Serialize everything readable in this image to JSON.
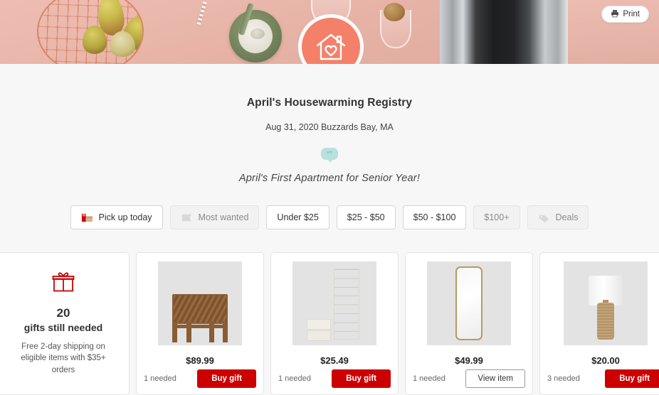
{
  "banner": {
    "print_label": "Print",
    "print_icon": "printer-icon",
    "avatar_icon": "house-heart-icon",
    "avatar_color": "#f58069"
  },
  "registry": {
    "title": "April's Housewarming Registry",
    "meta": "Aug 31, 2020 Buzzards Bay, MA",
    "quote_glyph": "“”",
    "note": "April's First Apartment for Senior Year!"
  },
  "filters": [
    {
      "label": "Pick up today",
      "icon": "store-pickup-icon",
      "disabled": false
    },
    {
      "label": "Most wanted",
      "icon": "ribbon-icon",
      "disabled": true
    },
    {
      "label": "Under $25",
      "icon": "",
      "disabled": false
    },
    {
      "label": "$25 - $50",
      "icon": "",
      "disabled": false
    },
    {
      "label": "$50 - $100",
      "icon": "",
      "disabled": false
    },
    {
      "label": "$100+",
      "icon": "",
      "disabled": true
    },
    {
      "label": "Deals",
      "icon": "tag-icon",
      "disabled": true
    }
  ],
  "gift_summary": {
    "icon": "gift-box-icon",
    "count": "20",
    "label": "gifts still needed",
    "subtext": "Free 2-day shipping on eligible items with $35+ orders"
  },
  "products": [
    {
      "image": "woven-accent-chair",
      "price": "$89.99",
      "needed": "1 needed",
      "action": "Buy gift",
      "action_type": "buy"
    },
    {
      "image": "hanging-closet-organizer",
      "price": "$25.49",
      "needed": "1 needed",
      "action": "Buy gift",
      "action_type": "buy"
    },
    {
      "image": "full-length-mirror",
      "price": "$49.99",
      "needed": "1 needed",
      "action": "View item",
      "action_type": "view"
    },
    {
      "image": "table-lamp",
      "price": "$20.00",
      "needed": "3 needed",
      "action": "Buy gift",
      "action_type": "buy"
    }
  ],
  "colors": {
    "brand_red": "#cc0000",
    "accent_coral": "#f58069",
    "bubble_teal": "#b9e0dc"
  }
}
